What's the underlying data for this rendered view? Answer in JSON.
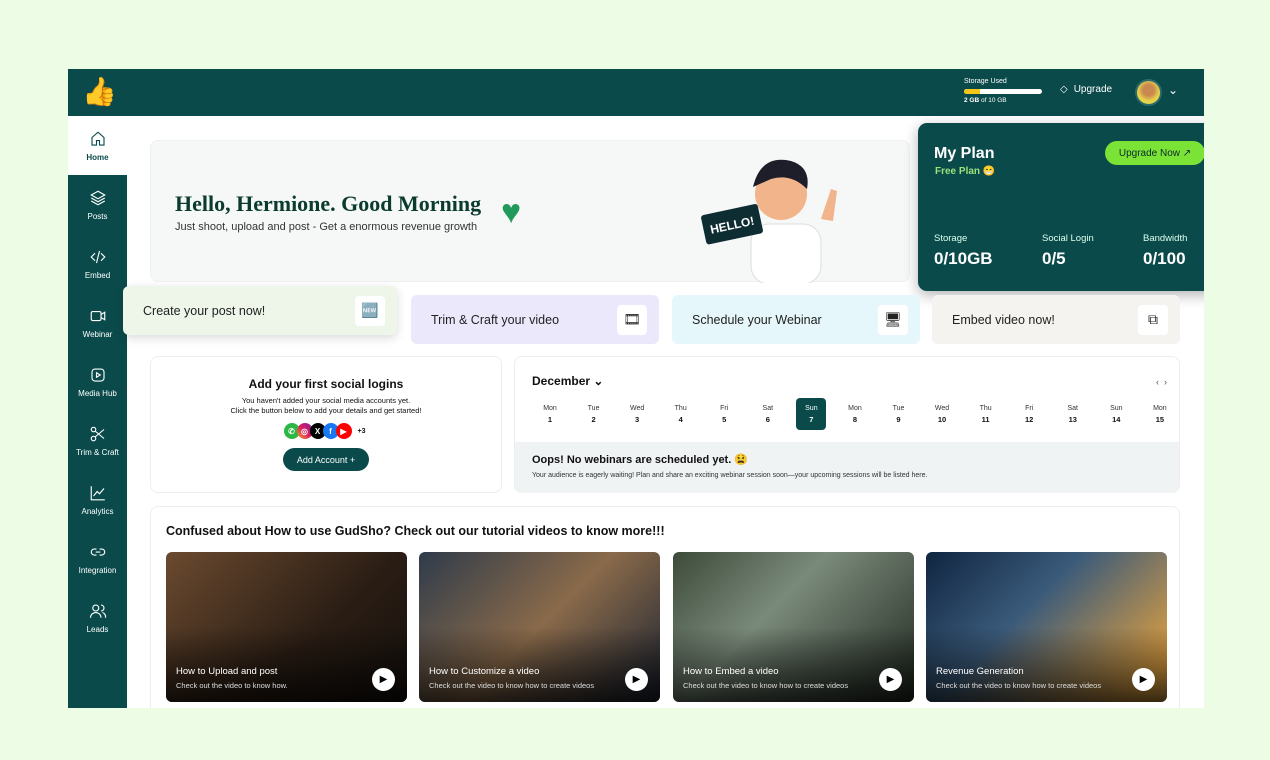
{
  "header": {
    "logo": "👍",
    "storage_label": "Storage Used",
    "storage_used": "2 GB",
    "storage_of": "of 10 GB",
    "storage_fraction": 0.2,
    "upgrade": "Upgrade",
    "chevron": "⌄"
  },
  "sidebar": {
    "items": [
      {
        "label": "Home",
        "icon": "home-icon"
      },
      {
        "label": "Posts",
        "icon": "layers-icon"
      },
      {
        "label": "Embed",
        "icon": "code-icon"
      },
      {
        "label": "Webinar",
        "icon": "video-icon"
      },
      {
        "label": "Media Hub",
        "icon": "media-icon"
      },
      {
        "label": "Trim & Craft",
        "icon": "scissors-icon"
      },
      {
        "label": "Analytics",
        "icon": "chart-icon"
      },
      {
        "label": "Integration",
        "icon": "link-icon"
      },
      {
        "label": "Leads",
        "icon": "users-icon"
      }
    ]
  },
  "hero": {
    "greeting": "Hello, Hermione. Good Morning",
    "subtitle": "Just shoot, upload and post - Get a enormous revenue growth",
    "sign": "HELLO!"
  },
  "plan": {
    "title": "My Plan",
    "plan_name": "Free Plan 😁",
    "upgrade_button": "Upgrade Now ↗",
    "stats": [
      {
        "label": "Storage",
        "value": "0/10GB"
      },
      {
        "label": "Social Login",
        "value": "0/5"
      },
      {
        "label": "Bandwidth",
        "value": "0/100"
      }
    ]
  },
  "actions": [
    {
      "label": "Create your post now!",
      "color": "#eef6ea"
    },
    {
      "label": "Trim & Craft your video",
      "color": "#ebe8fb"
    },
    {
      "label": "Schedule your Webinar",
      "color": "#e5f7fb"
    },
    {
      "label": "Embed video now!",
      "color": "#f4f3ef"
    }
  ],
  "social": {
    "title": "Add your first social logins",
    "line1": "You haven't added your social media accounts yet.",
    "line2": "Click the button below to add your details and get started!",
    "more": "+3",
    "button": "Add Account +"
  },
  "calendar": {
    "month": "December ⌄",
    "prev": "‹",
    "next": "›",
    "days": [
      {
        "d": "Mon",
        "n": "1"
      },
      {
        "d": "Tue",
        "n": "2"
      },
      {
        "d": "Wed",
        "n": "3"
      },
      {
        "d": "Thu",
        "n": "4"
      },
      {
        "d": "Fri",
        "n": "5"
      },
      {
        "d": "Sat",
        "n": "6"
      },
      {
        "d": "Sun",
        "n": "7"
      },
      {
        "d": "Mon",
        "n": "8"
      },
      {
        "d": "Tue",
        "n": "9"
      },
      {
        "d": "Wed",
        "n": "10"
      },
      {
        "d": "Thu",
        "n": "11"
      },
      {
        "d": "Fri",
        "n": "12"
      },
      {
        "d": "Sat",
        "n": "13"
      },
      {
        "d": "Sun",
        "n": "14"
      },
      {
        "d": "Mon",
        "n": "15"
      }
    ],
    "selected": "7",
    "empty_title": "Oops! No webinars are scheduled yet. 😫",
    "empty_text": "Your audience is eagerly waiting! Plan and share an exciting webinar session soon—your upcoming sessions will be listed here."
  },
  "tutorials": {
    "title": "Confused about How to use GudSho? Check out our tutorial videos to know more!!!",
    "videos": [
      {
        "title": "How to Upload and post",
        "sub": "Check out the video to know how."
      },
      {
        "title": "How to Customize a video",
        "sub": "Check out the video to know how to create videos"
      },
      {
        "title": "How to Embed a video",
        "sub": "Check out the video to know how to create videos"
      },
      {
        "title": "Revenue Generation",
        "sub": "Check out the video to know how to create videos"
      }
    ]
  }
}
